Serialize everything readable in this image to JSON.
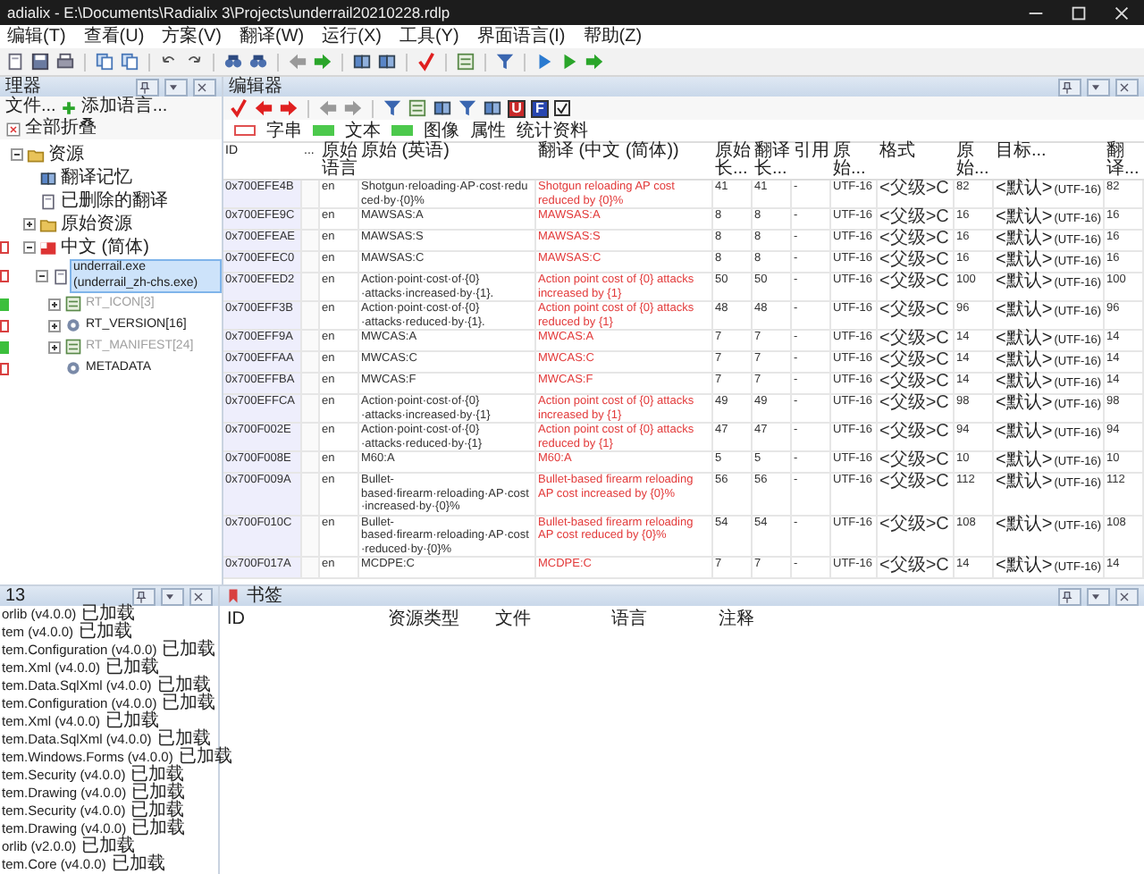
{
  "window": {
    "title": "adialix - E:\\Documents\\Radialix 3\\Projects\\underrail20210228.rdlp"
  },
  "menu": [
    "编辑(T)",
    "查看(U)",
    "方案(V)",
    "翻译(W)",
    "运行(X)",
    "工具(Y)",
    "界面语言(I)",
    "帮助(Z)"
  ],
  "manager": {
    "title": "理器",
    "toolbar": [
      "文件...",
      "添加语言...",
      "全部折叠"
    ],
    "tree": [
      {
        "label": "资源",
        "kind": "root",
        "expanded": true,
        "selected": false,
        "children": [
          {
            "label": "翻译记忆",
            "kind": "memory",
            "selected": false
          },
          {
            "label": "已删除的翻译",
            "kind": "deleted",
            "selected": false
          },
          {
            "label": "原始资源",
            "kind": "source",
            "expanded": false,
            "selected": false
          },
          {
            "label": "中文 (简体)",
            "kind": "language",
            "expanded": true,
            "marker": {
              "color": "#d94040",
              "filled": false
            },
            "selected": false,
            "children": [
              {
                "label": "underrail.exe (underrail_zh-chs.exe)",
                "kind": "file",
                "expanded": true,
                "marker": {
                  "color": "#d94040",
                  "filled": false
                },
                "selected": true,
                "children": [
                  {
                    "label": "RT_ICON[3]",
                    "kind": "icon-res",
                    "expanded": false,
                    "marker": {
                      "color": "#3cbf3c",
                      "filled": true
                    },
                    "dimmed": true,
                    "selected": false
                  },
                  {
                    "label": "RT_VERSION[16]",
                    "kind": "version",
                    "expanded": false,
                    "marker": {
                      "color": "#d94040",
                      "filled": false
                    },
                    "dimmed": false,
                    "selected": false
                  },
                  {
                    "label": "RT_MANIFEST[24]",
                    "kind": "manifest",
                    "expanded": false,
                    "marker": {
                      "color": "#3cbf3c",
                      "filled": true
                    },
                    "dimmed": true,
                    "selected": false
                  },
                  {
                    "label": "METADATA",
                    "kind": "metadata",
                    "marker": {
                      "color": "#d94040",
                      "filled": false
                    },
                    "dimmed": false,
                    "selected": false
                  }
                ]
              }
            ]
          }
        ]
      }
    ]
  },
  "editor": {
    "title": "编辑器",
    "toolbar_letters": [
      "U",
      "F"
    ],
    "checkbox": {
      "checked": true
    },
    "legend": [
      {
        "label": "字串",
        "swatch": {
          "color": "#e05050",
          "filled": false
        }
      },
      {
        "label": "文本",
        "swatch": {
          "color": "#4cc94c",
          "filled": true
        }
      },
      {
        "label": "图像",
        "swatch": {
          "color": "#4cc94c",
          "filled": true
        }
      },
      {
        "label": "属性"
      },
      {
        "label": "统计资料"
      }
    ],
    "columns": [
      "ID",
      "...",
      "原始语言",
      "原始 (英语)",
      "翻译 (中文 (简体))",
      "原始长...",
      "翻译长...",
      "引用",
      "原始...",
      "格式",
      "原始...",
      "目标...",
      "翻译..."
    ],
    "rows": [
      {
        "id": "0x700EFE4B",
        "lang": "en",
        "source": "Shotgun·reloading·AP·cost·reduced·by·{0}%",
        "translation": "Shotgun reloading AP cost reduced by {0}%",
        "source_len": "41",
        "trans_len": "41",
        "ref": "-",
        "encoding": "UTF-16",
        "format": "<父级>C",
        "source_size": "82",
        "target": "<默认>",
        "target_encoding": "(UTF-16)",
        "trans_size": "82"
      },
      {
        "id": "0x700EFE9C",
        "lang": "en",
        "source": "MAWSAS:A",
        "translation": "MAWSAS:A",
        "source_len": "8",
        "trans_len": "8",
        "ref": "-",
        "encoding": "UTF-16",
        "format": "<父级>C",
        "source_size": "16",
        "target": "<默认>",
        "target_encoding": "(UTF-16)",
        "trans_size": "16"
      },
      {
        "id": "0x700EFEAE",
        "lang": "en",
        "source": "MAWSAS:S",
        "translation": "MAWSAS:S",
        "source_len": "8",
        "trans_len": "8",
        "ref": "-",
        "encoding": "UTF-16",
        "format": "<父级>C",
        "source_size": "16",
        "target": "<默认>",
        "target_encoding": "(UTF-16)",
        "trans_size": "16"
      },
      {
        "id": "0x700EFEC0",
        "lang": "en",
        "source": "MAWSAS:C",
        "translation": "MAWSAS:C",
        "source_len": "8",
        "trans_len": "8",
        "ref": "-",
        "encoding": "UTF-16",
        "format": "<父级>C",
        "source_size": "16",
        "target": "<默认>",
        "target_encoding": "(UTF-16)",
        "trans_size": "16"
      },
      {
        "id": "0x700EFED2",
        "lang": "en",
        "source": "Action·point·cost·of·{0}·attacks·increased·by·{1}.",
        "translation": "Action point cost of {0} attacks increased by {1}",
        "source_len": "50",
        "trans_len": "50",
        "ref": "-",
        "encoding": "UTF-16",
        "format": "<父级>C",
        "source_size": "100",
        "target": "<默认>",
        "target_encoding": "(UTF-16)",
        "trans_size": "100"
      },
      {
        "id": "0x700EFF3B",
        "lang": "en",
        "source": "Action·point·cost·of·{0}·attacks·reduced·by·{1}.",
        "translation": "Action point cost of {0} attacks reduced by {1}",
        "source_len": "48",
        "trans_len": "48",
        "ref": "-",
        "encoding": "UTF-16",
        "format": "<父级>C",
        "source_size": "96",
        "target": "<默认>",
        "target_encoding": "(UTF-16)",
        "trans_size": "96"
      },
      {
        "id": "0x700EFF9A",
        "lang": "en",
        "source": "MWCAS:A",
        "translation": "MWCAS:A",
        "source_len": "7",
        "trans_len": "7",
        "ref": "-",
        "encoding": "UTF-16",
        "format": "<父级>C",
        "source_size": "14",
        "target": "<默认>",
        "target_encoding": "(UTF-16)",
        "trans_size": "14"
      },
      {
        "id": "0x700EFFAA",
        "lang": "en",
        "source": "MWCAS:C",
        "translation": "MWCAS:C",
        "source_len": "7",
        "trans_len": "7",
        "ref": "-",
        "encoding": "UTF-16",
        "format": "<父级>C",
        "source_size": "14",
        "target": "<默认>",
        "target_encoding": "(UTF-16)",
        "trans_size": "14"
      },
      {
        "id": "0x700EFFBA",
        "lang": "en",
        "source": "MWCAS:F",
        "translation": "MWCAS:F",
        "source_len": "7",
        "trans_len": "7",
        "ref": "-",
        "encoding": "UTF-16",
        "format": "<父级>C",
        "source_size": "14",
        "target": "<默认>",
        "target_encoding": "(UTF-16)",
        "trans_size": "14"
      },
      {
        "id": "0x700EFFCA",
        "lang": "en",
        "source": "Action·point·cost·of·{0}·attacks·increased·by·{1}",
        "translation": "Action point cost of {0} attacks increased by {1}",
        "source_len": "49",
        "trans_len": "49",
        "ref": "-",
        "encoding": "UTF-16",
        "format": "<父级>C",
        "source_size": "98",
        "target": "<默认>",
        "target_encoding": "(UTF-16)",
        "trans_size": "98"
      },
      {
        "id": "0x700F002E",
        "lang": "en",
        "source": "Action·point·cost·of·{0}·attacks·reduced·by·{1}",
        "translation": "Action point cost of {0} attacks reduced by {1}",
        "source_len": "47",
        "trans_len": "47",
        "ref": "-",
        "encoding": "UTF-16",
        "format": "<父级>C",
        "source_size": "94",
        "target": "<默认>",
        "target_encoding": "(UTF-16)",
        "trans_size": "94"
      },
      {
        "id": "0x700F008E",
        "lang": "en",
        "source": "M60:A",
        "translation": "M60:A",
        "source_len": "5",
        "trans_len": "5",
        "ref": "-",
        "encoding": "UTF-16",
        "format": "<父级>C",
        "source_size": "10",
        "target": "<默认>",
        "target_encoding": "(UTF-16)",
        "trans_size": "10"
      },
      {
        "id": "0x700F009A",
        "lang": "en",
        "source": "Bullet-based·firearm·reloading·AP·cost·increased·by·{0}%",
        "translation": "Bullet-based firearm reloading AP cost increased by {0}%",
        "source_len": "56",
        "trans_len": "56",
        "ref": "-",
        "encoding": "UTF-16",
        "format": "<父级>C",
        "source_size": "112",
        "target": "<默认>",
        "target_encoding": "(UTF-16)",
        "trans_size": "112"
      },
      {
        "id": "0x700F010C",
        "lang": "en",
        "source": "Bullet-based·firearm·reloading·AP·cost·reduced·by·{0}%",
        "translation": "Bullet-based firearm reloading AP cost reduced by {0}%",
        "source_len": "54",
        "trans_len": "54",
        "ref": "-",
        "encoding": "UTF-16",
        "format": "<父级>C",
        "source_size": "108",
        "target": "<默认>",
        "target_encoding": "(UTF-16)",
        "trans_size": "108"
      },
      {
        "id": "0x700F017A",
        "lang": "en",
        "source": "MCDPE:C",
        "translation": "MCDPE:C",
        "source_len": "7",
        "trans_len": "7",
        "ref": "-",
        "encoding": "UTF-16",
        "format": "<父级>C",
        "source_size": "14",
        "target": "<默认>",
        "target_encoding": "(UTF-16)",
        "trans_size": "14"
      }
    ]
  },
  "assemblies": {
    "title": "13",
    "items": [
      {
        "name": "orlib (v4.0.0)",
        "status": "已加载"
      },
      {
        "name": "tem (v4.0.0)",
        "status": "已加载"
      },
      {
        "name": "tem.Configuration (v4.0.0)",
        "status": "已加载"
      },
      {
        "name": "tem.Xml (v4.0.0)",
        "status": "已加载"
      },
      {
        "name": "tem.Data.SqlXml (v4.0.0)",
        "status": "已加载"
      },
      {
        "name": "tem.Configuration (v4.0.0)",
        "status": "已加载"
      },
      {
        "name": "tem.Xml (v4.0.0)",
        "status": "已加载"
      },
      {
        "name": "tem.Data.SqlXml (v4.0.0)",
        "status": "已加载"
      },
      {
        "name": "tem.Windows.Forms (v4.0.0)",
        "status": "已加载"
      },
      {
        "name": "tem.Security (v4.0.0)",
        "status": "已加载"
      },
      {
        "name": "tem.Drawing (v4.0.0)",
        "status": "已加载"
      },
      {
        "name": "tem.Security (v4.0.0)",
        "status": "已加载"
      },
      {
        "name": "tem.Drawing (v4.0.0)",
        "status": "已加载"
      },
      {
        "name": "orlib (v2.0.0)",
        "status": "已加载"
      },
      {
        "name": "tem.Core (v4.0.0)",
        "status": "已加载"
      }
    ]
  },
  "bookmarks": {
    "title": "书签",
    "columns": [
      "ID",
      "资源类型",
      "文件",
      "语言",
      "注释"
    ]
  }
}
